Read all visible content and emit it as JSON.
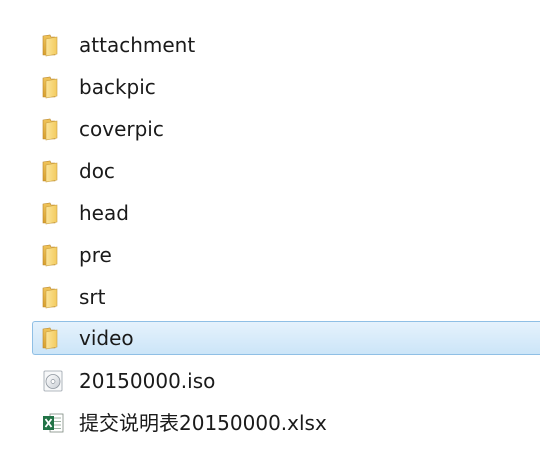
{
  "files": [
    {
      "name": "attachment",
      "type": "folder",
      "icon": "folder-icon"
    },
    {
      "name": "backpic",
      "type": "folder",
      "icon": "folder-icon"
    },
    {
      "name": "coverpic",
      "type": "folder",
      "icon": "folder-icon"
    },
    {
      "name": "doc",
      "type": "folder",
      "icon": "folder-icon"
    },
    {
      "name": "head",
      "type": "folder",
      "icon": "folder-icon"
    },
    {
      "name": "pre",
      "type": "folder",
      "icon": "folder-icon"
    },
    {
      "name": "srt",
      "type": "folder",
      "icon": "folder-icon"
    },
    {
      "name": "video",
      "type": "folder",
      "icon": "folder-icon",
      "selected": true
    },
    {
      "name": "20150000.iso",
      "type": "iso",
      "icon": "disc-image-icon"
    },
    {
      "name": "提交说明表20150000.xlsx",
      "type": "xlsx",
      "icon": "excel-icon"
    }
  ],
  "colors": {
    "selection_fill": "#cce5f8",
    "selection_border": "#8fbfe5",
    "folder": "#e7b94a",
    "excel": "#217346"
  }
}
